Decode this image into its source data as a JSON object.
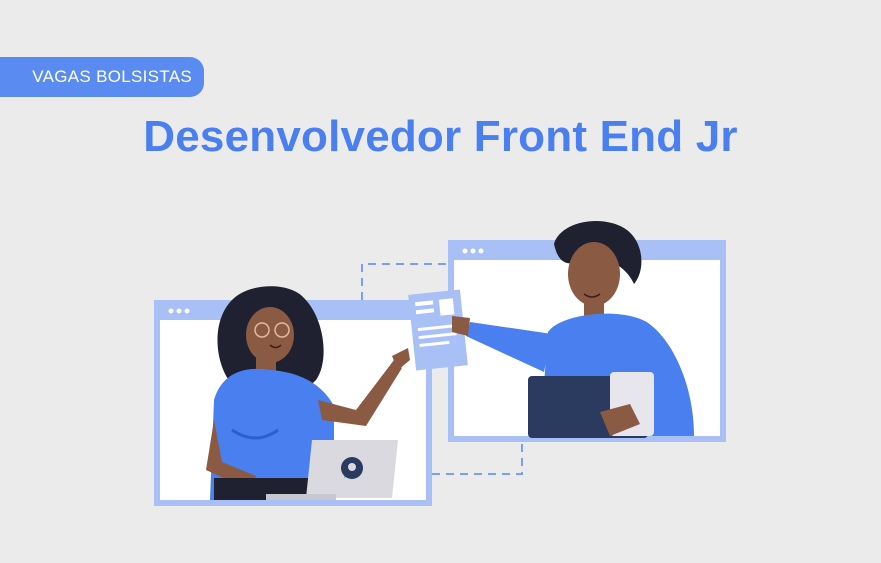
{
  "badge": {
    "label": "VAGAS BOLSISTAS"
  },
  "headline": {
    "text": "Desenvolvedor Front End Jr"
  },
  "colors": {
    "background": "#ebebeb",
    "accent": "#4a7ff0",
    "badge": "#5a8bf0",
    "window_frame": "#a9c0f6",
    "shirt": "#4a7ff0",
    "skin": "#8a5a43",
    "hair": "#1f2130",
    "laptop": "#d9d9df",
    "tablet": "#2b3a5f"
  },
  "illustration": {
    "description_icons": [
      "woman-with-laptop-illustration",
      "man-with-tablet-illustration",
      "resume-card-icon"
    ]
  }
}
